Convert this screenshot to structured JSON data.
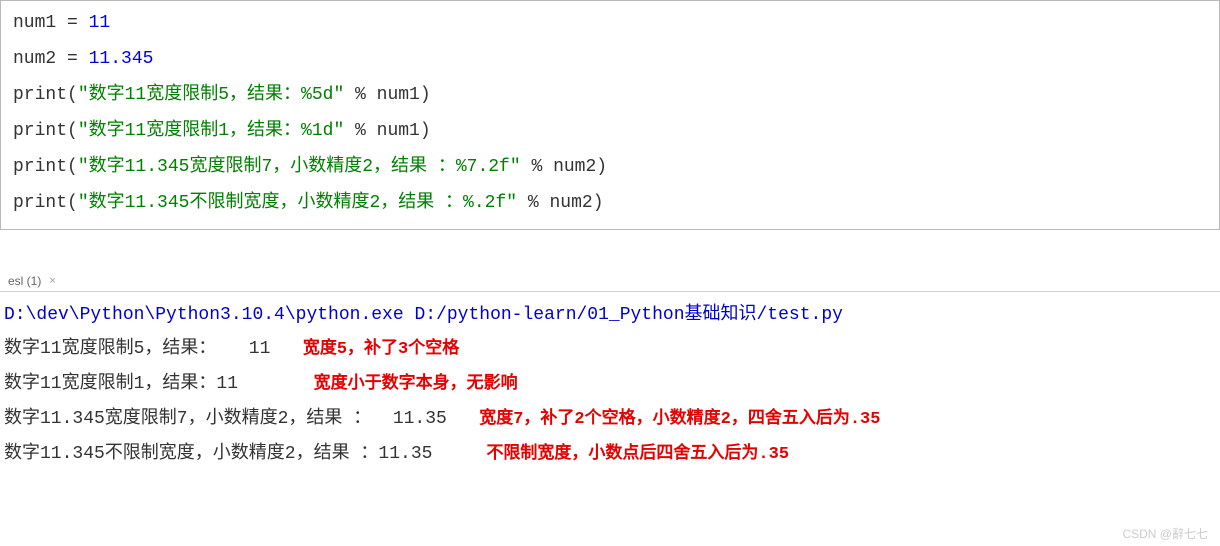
{
  "code": {
    "line1": {
      "var": "num1",
      "eq": " = ",
      "val": "11"
    },
    "line2": {
      "var": "num2",
      "eq": " = ",
      "val": "11.345"
    },
    "line3": {
      "func": "print",
      "open": "(",
      "str": "\"数字11宽度限制5，结果：%5d\"",
      "op": " % ",
      "arg": "num1",
      "close": ")"
    },
    "line4": {
      "func": "print",
      "open": "(",
      "str": "\"数字11宽度限制1，结果：%1d\"",
      "op": " % ",
      "arg": "num1",
      "close": ")"
    },
    "line5": {
      "func": "print",
      "open": "(",
      "str": "\"数字11.345宽度限制7，小数精度2，结果 ：%7.2f\"",
      "op": " % ",
      "arg": "num2",
      "close": ")"
    },
    "line6": {
      "func": "print",
      "open": "(",
      "str": "\"数字11.345不限制宽度，小数精度2，结果 ：%.2f\"",
      "op": " % ",
      "arg": "num2",
      "close": ")"
    }
  },
  "tab": {
    "label": "esl (1)",
    "close": "×"
  },
  "output": {
    "cmd": "D:\\dev\\Python\\Python3.10.4\\python.exe D:/python-learn/01_Python基础知识/test.py",
    "line1": {
      "text": "数字11宽度限制5，结果：   11   ",
      "note": "宽度5，补了3个空格"
    },
    "line2": {
      "text": "数字11宽度限制1，结果：11       ",
      "note": "宽度小于数字本身，无影响"
    },
    "line3": {
      "text": "数字11.345宽度限制7，小数精度2，结果 ：  11.35   ",
      "note": "宽度7，补了2个空格，小数精度2，四舍五入后为.35"
    },
    "line4": {
      "text": "数字11.345不限制宽度，小数精度2，结果 ：11.35     ",
      "note": "不限制宽度，小数点后四舍五入后为.35"
    }
  },
  "watermark": "CSDN @辭七七"
}
